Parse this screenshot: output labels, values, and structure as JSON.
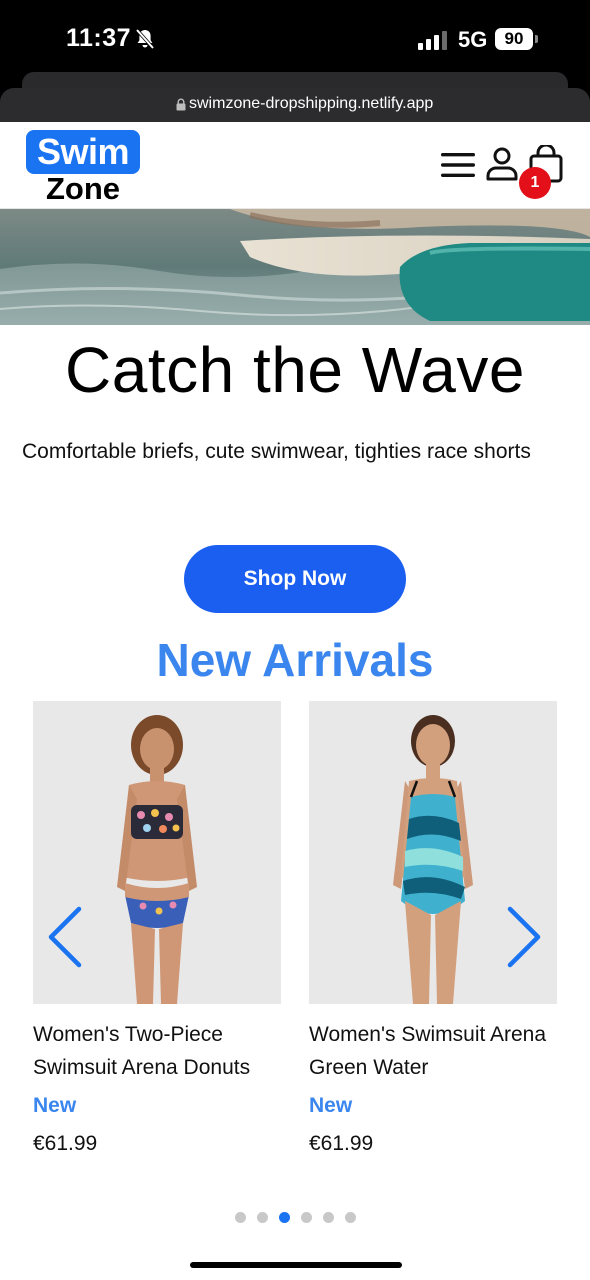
{
  "status_bar": {
    "time": "11:37",
    "network": "5G",
    "battery": "90"
  },
  "browser": {
    "url": "swimzone-dropshipping.netlify.app"
  },
  "header": {
    "logo_top": "Swim",
    "logo_bottom": "Zone",
    "cart_count": "1",
    "icons": [
      "menu-icon",
      "account-icon",
      "shopping-bag-icon"
    ]
  },
  "hero": {
    "title": "Catch the Wave",
    "subtitle": "Comfortable briefs, cute swimwear, tighties race shorts",
    "cta_label": "Shop Now"
  },
  "new_arrivals": {
    "title": "New Arrivals",
    "products": [
      {
        "name": "Women's Two-Piece Swimsuit Arena Donuts",
        "badge": "New",
        "price": "€61.99"
      },
      {
        "name": "Women's Swimsuit Arena Green Water",
        "badge": "New",
        "price": "€61.99"
      }
    ],
    "carousel": {
      "dot_count": 6,
      "active_index": 2
    }
  },
  "colors": {
    "brand_blue": "#1a73f0",
    "accent_blue": "#3a86ee",
    "cta_blue": "#1a5ff0",
    "badge_red": "#e3101a"
  }
}
